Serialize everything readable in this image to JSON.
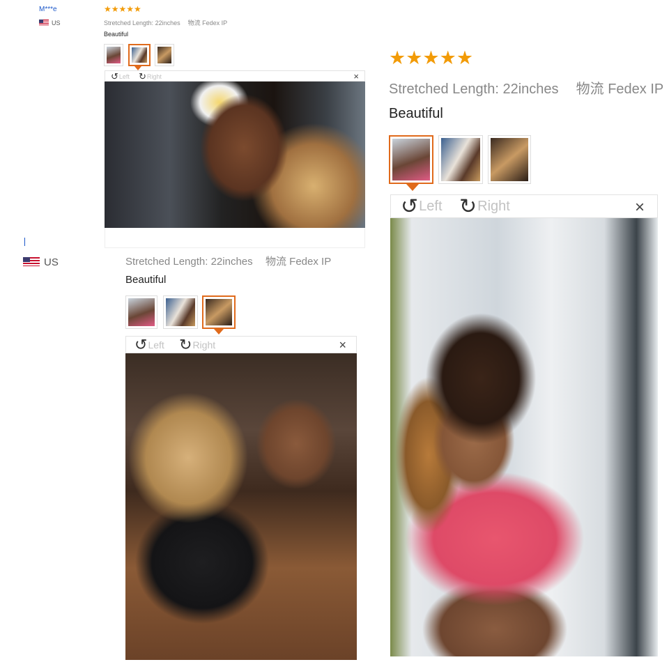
{
  "review_small": {
    "user": "M***e",
    "country": "US",
    "stars": "★★★★★",
    "length_label": "Stretched Length:",
    "length_value": "22inches",
    "shipping_label": "物流",
    "shipping_value": "Fedex IP",
    "comment": "Beautiful",
    "toolbar": {
      "left": "Left",
      "right": "Right",
      "close": "×"
    }
  },
  "review_middle": {
    "country": "US",
    "length_label": "Stretched Length:",
    "length_value": "22inches",
    "shipping_label": "物流",
    "shipping_value": "Fedex IP",
    "comment": "Beautiful",
    "toolbar": {
      "left": "Left",
      "right": "Right",
      "close": "×"
    }
  },
  "review_large": {
    "stars": "★★★★★",
    "length_label": "Stretched Length:",
    "length_value": "22inches",
    "shipping_label": "物流",
    "shipping_value": "Fedex IP",
    "comment": "Beautiful",
    "toolbar": {
      "left": "Left",
      "right": "Right",
      "close": "×"
    }
  },
  "icons": {
    "rotate_left": "↺",
    "rotate_right": "↻"
  },
  "colors": {
    "star": "#f29b07",
    "active_thumb_border": "#e06a1b",
    "username_link": "#1a56c9"
  }
}
